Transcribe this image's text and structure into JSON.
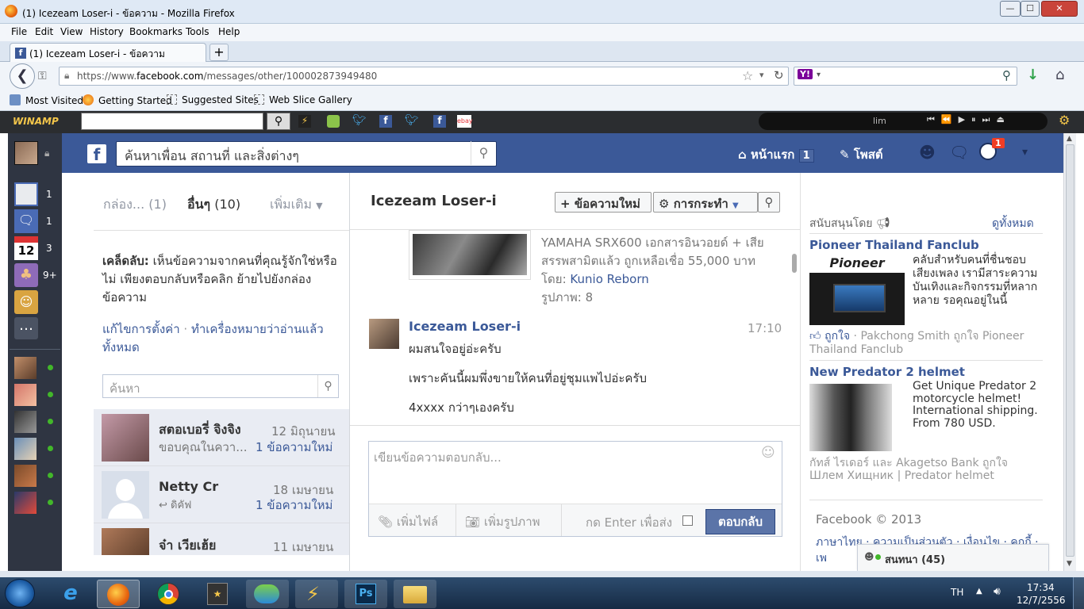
{
  "window": {
    "title": "(1) Icezeam Loser-i - ข้อความ - Mozilla Firefox",
    "min": "—",
    "max": "☐",
    "close": "✕"
  },
  "menu": [
    "File",
    "Edit",
    "View",
    "History",
    "Bookmarks",
    "Tools",
    "Help"
  ],
  "tab": {
    "title": "(1) Icezeam Loser-i - ข้อความ",
    "new_tab": "+"
  },
  "url": {
    "prefix": "https://www.",
    "domain": "facebook.com",
    "path": "/messages/other/100002873949480"
  },
  "search_engine": "Y!",
  "bookmarks": [
    "Most Visited",
    "Getting Started",
    "Suggested Sites",
    "Web Slice Gallery"
  ],
  "winamp": {
    "logo": "WINAMP",
    "track": "lim"
  },
  "fb": {
    "search_placeholder": "ค้นหาเพื่อน สถานที่ และสิ่งต่างๆ",
    "home": "หน้าแรก",
    "home_count": "1",
    "post": "โพสต์",
    "notif_count": "1"
  },
  "sidebar_apps": [
    {
      "icon": "news-feed-icon",
      "count": "1"
    },
    {
      "icon": "messages-icon",
      "count": "1"
    },
    {
      "icon": "calendar-icon",
      "label": "12",
      "count": "3"
    },
    {
      "icon": "games-icon",
      "count": "9+"
    },
    {
      "icon": "groups-icon",
      "count": ""
    }
  ],
  "folders": {
    "inbox": "กล่อง...",
    "inbox_count": "(1)",
    "other": "อื่นๆ",
    "other_count": "(10)",
    "more": "เพิ่มเติม"
  },
  "tip": {
    "label": "เคล็ดลับ:",
    "text": "เห็นข้อความจากคนที่คุณรู้จักใช่หรือไม่ เพียงตอบกลับหรือคลิก ย้ายไปยังกล่องข้อความ",
    "edit_settings": "แก้ไขการตั้งค่า",
    "sep": " · ",
    "mark_read": "ทำเครื่องหมายว่าอ่านแล้วทั้งหมด"
  },
  "search_placeholder": "ค้นหา",
  "threads": [
    {
      "name": "สตอเบอรี่ จิงจิง",
      "date": "12 มิถุนายน",
      "snippet": "ขอบคุณในควา...",
      "status": "1 ข้อความใหม่"
    },
    {
      "name": "Netty Cr",
      "date": "18 เมษายน",
      "snippet": "ดิคัฟ",
      "status": "1 ข้อความใหม่"
    },
    {
      "name": "จ๋า เวียเฮ้ย",
      "date": "11 เมษายน",
      "snippet": "",
      "status": ""
    }
  ],
  "conversation": {
    "title": "Icezeam Loser-i",
    "new_message": "ข้อความใหม่",
    "actions": "การกระทำ",
    "share": {
      "text1": "YAMAHA SRX600 เอกสารอินวอยด์ + เสีย",
      "text2": "สรรพสามิตแล้ว ถูกเหลือเชื่อ 55,000 บาท",
      "by_label": "โดย:",
      "by": "Kunio Reborn",
      "photos": "รูปภาพ: 8"
    },
    "message": {
      "sender": "Icezeam Loser-i",
      "time": "17:10",
      "lines": [
        "ผมสนใจอยู่อ่ะครับ",
        "เพราะคันนี้ผมพึ่งขายให้คนที่อยู่ชุมแพไปอ่ะครับ",
        "4xxxx กว่าๆเองครับ"
      ]
    },
    "reply_placeholder": "เขียนข้อความตอบกลับ...",
    "add_file": "เพิ่มไฟล์",
    "add_photo": "เพิ่มรูปภาพ",
    "enter_to_send": "กด Enter เพื่อส่ง",
    "reply_button": "ตอบกลับ"
  },
  "ads": {
    "sponsored": "สนับสนุนโดย",
    "see_all": "ดูทั้งหมด",
    "items": [
      {
        "title": "Pioneer Thailand Fanclub",
        "logo": "Pioneer",
        "text": "คลับสำหรับคนที่ชื่นชอบเสียงเพลง เรามีสาระความบันเทิงและกิจกรรมที่หลากหลาย รอคุณอยู่ในนี้",
        "like": "ถูกใจ",
        "social": " · Pakchong Smith ถูกใจ Pioneer Thailand Fanclub"
      },
      {
        "title": "New Predator 2 helmet",
        "text": "Get Unique Predator 2 motorcycle helmet! International shipping. From 780 USD.",
        "social": "กัทส์ ไรเดอร์ และ Akagetso Bank ถูกใจ Шлем Хищник | Predator helmet"
      }
    ],
    "footer": "Facebook © 2013",
    "footer_links": "ภาษาไทย · ความเป็นส่วนตัว · เงื่อนไข · คุกกี้ · เพ",
    "chat": "สนทนา (45)"
  },
  "taskbar": {
    "lang": "TH",
    "time": "17:34",
    "date": "12/7/2556",
    "ps": "Ps"
  }
}
